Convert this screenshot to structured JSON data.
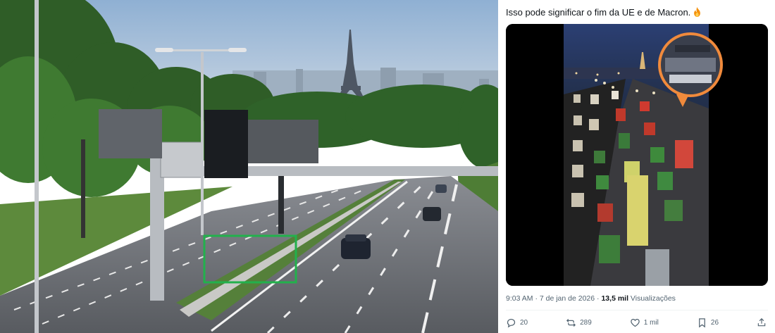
{
  "tweet": {
    "text": "Isso pode significar o fim da UE e de Macron.",
    "emoji_icon": "fire-icon",
    "time": "9:03 AM",
    "separator": " · ",
    "date": "7 de jan de 2026",
    "views_count": "13,5 mil",
    "views_label": "Visualizações"
  },
  "actions": {
    "replies": "20",
    "reposts": "289",
    "likes": "1 mil",
    "bookmarks": "26"
  },
  "icons": {
    "reply": "reply-icon",
    "repost": "repost-icon",
    "like": "heart-icon",
    "bookmark": "bookmark-icon",
    "share": "share-icon"
  },
  "colors": {
    "highlight_box": "#22b14c",
    "zoom_circle": "#f08a3c",
    "text_secondary": "#536471"
  }
}
